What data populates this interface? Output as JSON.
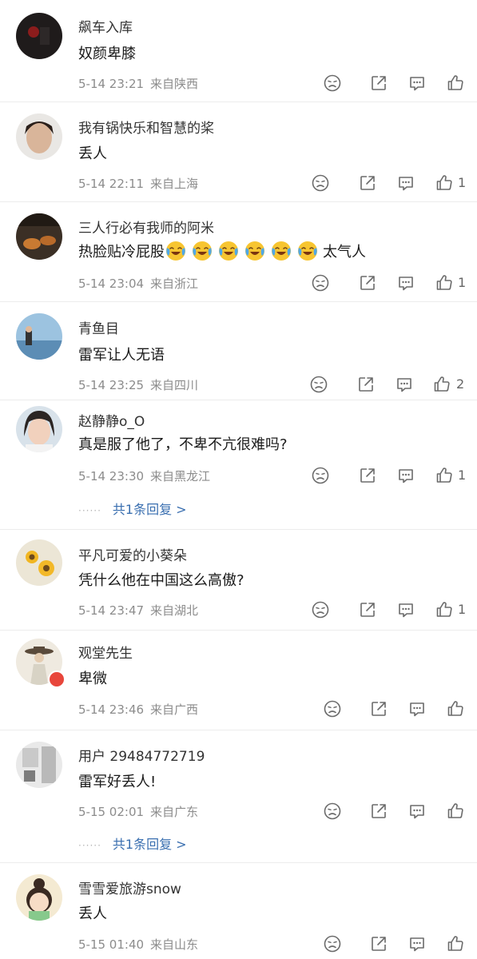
{
  "comments": [
    {
      "user": "飙车入库",
      "text": "奴颜卑膝",
      "time": "5-14 23:21",
      "location": "来自陕西",
      "likes": ""
    },
    {
      "user": "我有锅快乐和智慧的桨",
      "text": "丢人",
      "time": "5-14 22:11",
      "location": "来自上海",
      "likes": "1"
    },
    {
      "user": "三人行必有我师的阿米",
      "text": "热脸贴冷屁股",
      "text_suffix": "太气人",
      "time": "5-14 23:04",
      "location": "来自浙江",
      "likes": "1"
    },
    {
      "user": "青鱼目",
      "text": "雷军让人无语",
      "time": "5-14 23:25",
      "location": "来自四川",
      "likes": "2"
    },
    {
      "user": "赵静静o_O",
      "text": "真是服了他了，不卑不亢很难吗?",
      "time": "5-14 23:30",
      "location": "来自黑龙江",
      "likes": "1",
      "reply": "共1条回复 >"
    },
    {
      "user": "平凡可爱的小葵朵",
      "text": "凭什么他在中国这么高傲?",
      "time": "5-14 23:47",
      "location": "来自湖北",
      "likes": "1"
    },
    {
      "user": "观堂先生",
      "text": "卑微",
      "time": "5-14 23:46",
      "location": "来自广西",
      "likes": ""
    },
    {
      "user": "用户 29484772719",
      "text": "雷军好丢人!",
      "time": "5-15 02:01",
      "location": "来自广东",
      "likes": "",
      "reply": "共1条回复 >"
    },
    {
      "user": "雪雪爱旅游snow",
      "text": "丢人",
      "time": "5-15 01:40",
      "location": "来自山东",
      "likes": ""
    }
  ],
  "reply_dots": "······",
  "icons": {
    "dislike": "dislike-icon",
    "share": "share-icon",
    "comment": "comment-icon",
    "like": "thumbs-up-icon",
    "emoji": "crying-laughing-emoji"
  },
  "colors": {
    "icon": "#6b6b6b",
    "meta": "#8c8c8c",
    "reply_link": "#3a6fb0",
    "divider": "#ececec"
  }
}
